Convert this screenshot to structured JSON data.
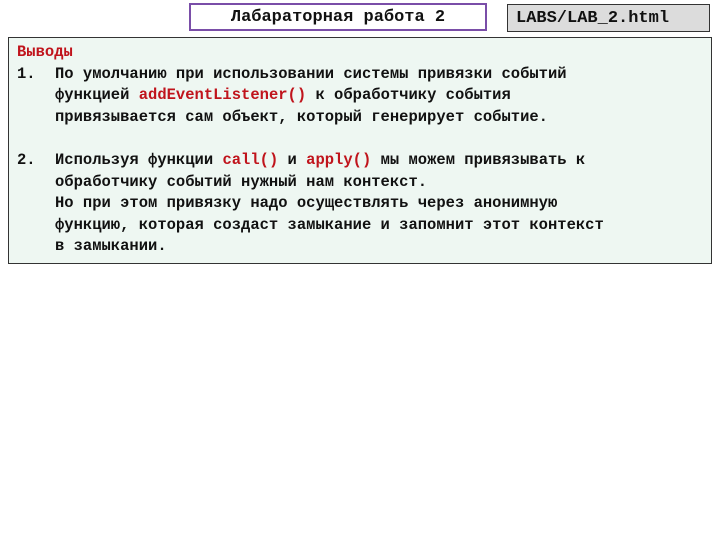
{
  "header": {
    "title": "Лабараторная работа 2",
    "file": "LABS/LAB_2.html"
  },
  "content": {
    "heading": "Выводы",
    "items": [
      {
        "number": "1.",
        "line1_a": "По умолчанию при использовании системы привязки событий",
        "line2_a": "функцией ",
        "line2_code": "addEventListener()",
        "line2_b": " к обработчику события",
        "line3": "привязывается сам объект, который генерирует событие."
      },
      {
        "number": "2.",
        "line1_a": "Используя функции ",
        "line1_code1": "call()",
        "line1_b": " и ",
        "line1_code2": "apply()",
        "line1_c": " мы можем привязывать к",
        "line2": "обработчику событий нужный нам контекст.",
        "line3": "Но при этом привязку надо осуществлять через анонимную",
        "line4": "функцию, которая создаст замыкание и запомнит этот контекст",
        "line5": "в замыкании."
      }
    ]
  },
  "colors": {
    "accent_red": "#c0141c",
    "title_border": "#7a4ea8",
    "content_bg": "#eef7f2",
    "file_bg": "#dcdcdc"
  }
}
